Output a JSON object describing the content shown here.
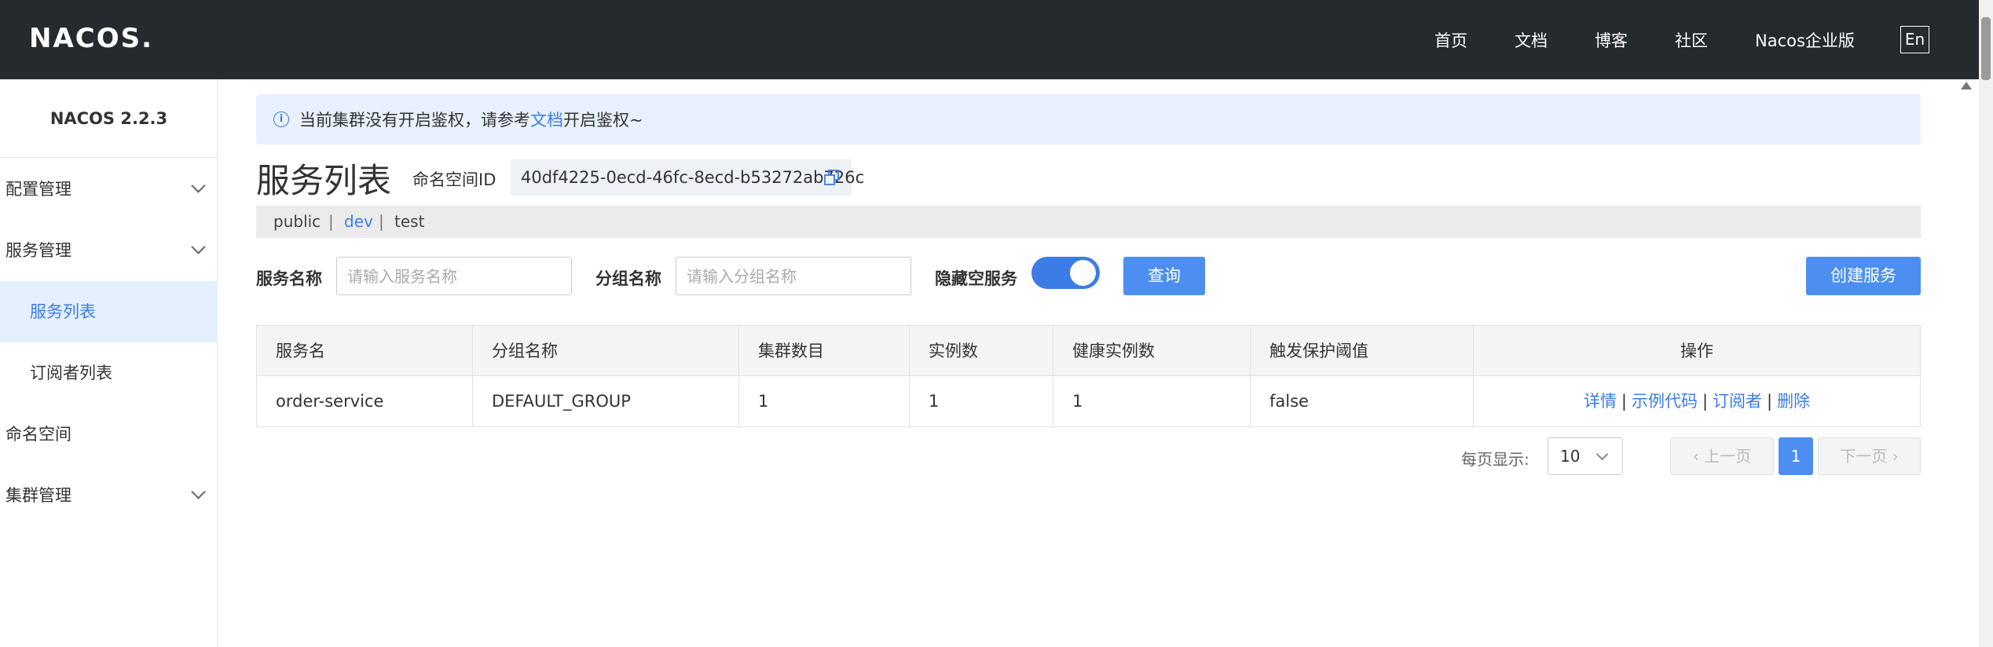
{
  "header": {
    "logo_text": "NACOS.",
    "nav": [
      "首页",
      "文档",
      "博客",
      "社区",
      "Nacos企业版"
    ],
    "lang_button": "En"
  },
  "sidebar": {
    "version": "NACOS 2.2.3",
    "items": [
      {
        "label": "配置管理"
      },
      {
        "label": "服务管理"
      },
      {
        "label": "服务列表"
      },
      {
        "label": "订阅者列表"
      },
      {
        "label": "命名空间"
      },
      {
        "label": "集群管理"
      }
    ]
  },
  "notice": {
    "prefix": "当前集群没有开启鉴权，请参考",
    "link": "文档",
    "suffix": "开启鉴权~"
  },
  "page": {
    "title": "服务列表",
    "namespace_label": "命名空间ID",
    "namespace_id": "40df4225-0ecd-46fc-8ecd-b53272ab726c"
  },
  "namespace_tabs": [
    "public",
    "dev",
    "test"
  ],
  "filters": {
    "service_name_label": "服务名称",
    "service_name_placeholder": "请输入服务名称",
    "group_name_label": "分组名称",
    "group_name_placeholder": "请输入分组名称",
    "hide_empty_label": "隐藏空服务",
    "hide_empty_on": true,
    "query_button": "查询",
    "create_button": "创建服务"
  },
  "table": {
    "headers": [
      "服务名",
      "分组名称",
      "集群数目",
      "实例数",
      "健康实例数",
      "触发保护阈值",
      "操作"
    ],
    "rows": [
      {
        "cells": [
          "order-service",
          "DEFAULT_GROUP",
          "1",
          "1",
          "1",
          "false"
        ],
        "actions": [
          "详情",
          "示例代码",
          "订阅者",
          "删除"
        ]
      }
    ]
  },
  "pagination": {
    "per_page_label": "每页显示:",
    "per_page_value": "10",
    "prev": "上一页",
    "current": "1",
    "next": "下一页"
  },
  "colors": {
    "header_bg": "#252a2f",
    "accent": "#3c7ce6",
    "button": "#4c8ff0",
    "active_bg": "#e5f0ff"
  }
}
